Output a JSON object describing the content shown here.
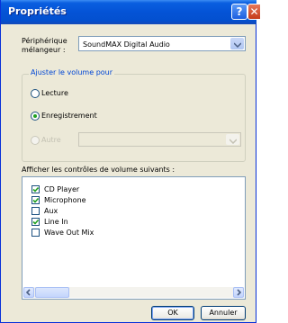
{
  "window": {
    "title": "Propriétés"
  },
  "device": {
    "label_line1": "Périphérique",
    "label_line2": "mélangeur :",
    "selected": "SoundMAX Digital Audio"
  },
  "adjust_group": {
    "legend": "Ajuster le volume pour",
    "options": [
      {
        "label": "Lecture",
        "selected": false,
        "enabled": true
      },
      {
        "label": "Enregistrement",
        "selected": true,
        "enabled": true
      },
      {
        "label": "Autre",
        "selected": false,
        "enabled": false
      }
    ]
  },
  "controls": {
    "header": "Afficher les contrôles de volume suivants :",
    "items": [
      {
        "label": "CD Player",
        "checked": true
      },
      {
        "label": "Microphone",
        "checked": true
      },
      {
        "label": "Aux",
        "checked": false
      },
      {
        "label": "Line In",
        "checked": true
      },
      {
        "label": "Wave Out Mix",
        "checked": false
      }
    ]
  },
  "buttons": {
    "ok": "OK",
    "cancel": "Annuler"
  },
  "colors": {
    "titlebar": "#0453d6",
    "dialog_bg": "#ece9d8",
    "accent_check": "#21a121"
  }
}
